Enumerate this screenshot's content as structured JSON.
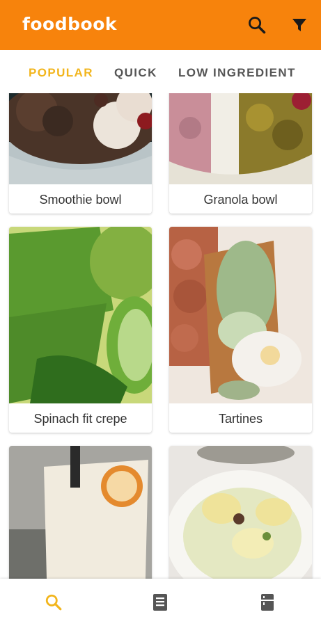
{
  "app": {
    "logo": "foodbook",
    "accent": "#f7830c",
    "active_tab_color": "#f2b51c"
  },
  "appbar": {
    "search_icon": "search-icon",
    "filter_icon": "filter-icon"
  },
  "tabs": [
    {
      "label": "POPULAR",
      "active": true
    },
    {
      "label": "QUICK",
      "active": false
    },
    {
      "label": "LOW INGREDIENT",
      "active": false
    }
  ],
  "recipes": [
    {
      "title": "Smoothie bowl"
    },
    {
      "title": "Granola bowl"
    },
    {
      "title": "Spinach fit crepe"
    },
    {
      "title": "Tartines"
    },
    {
      "title": ""
    },
    {
      "title": ""
    }
  ],
  "bottom_nav": [
    {
      "icon": "search-icon",
      "active": true
    },
    {
      "icon": "recipe-book-icon",
      "active": false
    },
    {
      "icon": "fridge-icon",
      "active": false
    }
  ]
}
